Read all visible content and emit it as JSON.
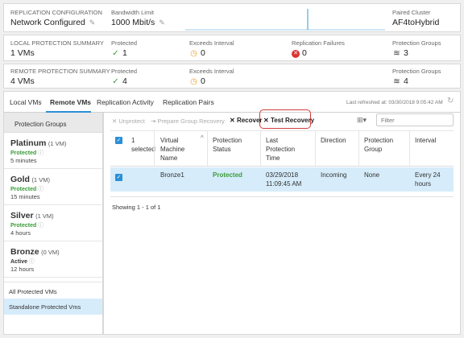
{
  "summary1": {
    "replication_configuration": {
      "label": "REPLICATION CONFIGURATION",
      "value": "Network Configured"
    },
    "bandwidth_limit": {
      "label": "Bandwidth Limit",
      "value": "1000 Mbit/s"
    },
    "paired_cluster": {
      "label": "Paired Cluster",
      "value": "AF4toHybrid"
    }
  },
  "local_summary": {
    "title": "LOCAL PROTECTION SUMMARY",
    "vms": "1 VMs",
    "protected": {
      "label": "Protected",
      "value": "1"
    },
    "exceeds_interval": {
      "label": "Exceeds Interval",
      "value": "0"
    },
    "replication_failures": {
      "label": "Replication Failures",
      "value": "0"
    },
    "protection_groups": {
      "label": "Protection Groups",
      "value": "3"
    }
  },
  "remote_summary": {
    "title": "REMOTE PROTECTION SUMMARY",
    "vms": "4 VMs",
    "protected": {
      "label": "Protected",
      "value": "4"
    },
    "exceeds_interval": {
      "label": "Exceeds Interval",
      "value": "0"
    },
    "protection_groups": {
      "label": "Protection Groups",
      "value": "4"
    }
  },
  "tabs": [
    {
      "label": "Local VMs"
    },
    {
      "label": "Remote VMs"
    },
    {
      "label": "Replication Activity"
    },
    {
      "label": "Replication Pairs"
    }
  ],
  "last_refreshed": "Last refreshed at: 03/30/2018 9:05:42 AM",
  "sidebar": {
    "header": "Protection Groups",
    "groups": [
      {
        "name": "Platinum",
        "count": "(1 VM)",
        "status": "Protected",
        "interval": "5 minutes"
      },
      {
        "name": "Gold",
        "count": "(1 VM)",
        "status": "Protected",
        "interval": "15 minutes"
      },
      {
        "name": "Silver",
        "count": "(1 VM)",
        "status": "Protected",
        "interval": "4 hours"
      },
      {
        "name": "Bronze",
        "count": "(0 VM)",
        "status": "Active",
        "interval": "12 hours"
      }
    ],
    "all_protected": "All Protected VMs",
    "standalone": "Standalone Protected Vms"
  },
  "toolbar": {
    "unprotect": "Unprotect",
    "prepare_group_recovery": "Prepare Group Recovery",
    "recover": "Recover",
    "test_recovery": "Test Recovery",
    "filter_placeholder": "Filter"
  },
  "table": {
    "selected_count": "1",
    "selected_label": "selected",
    "headers": {
      "vm_line1": "Virtual",
      "vm_line2": "Machine",
      "vm_line3": "Name",
      "status_line1": "Protection",
      "status_line2": "Status",
      "last_line1": "Last",
      "last_line2": "Protection",
      "last_line3": "Time",
      "direction": "Direction",
      "group_line1": "Protection",
      "group_line2": "Group",
      "interval": "Interval"
    },
    "rows": [
      {
        "vm": "Bronze1",
        "status": "Protected",
        "time_line1": "03/29/2018",
        "time_line2": "11:09:45 AM",
        "direction": "Incoming",
        "group": "None",
        "interval_line1": "Every 24",
        "interval_line2": "hours"
      }
    ],
    "showing": "Showing 1 - 1 of 1"
  },
  "colors": {
    "accent": "#2b8fd6",
    "protected_green": "#3a9b3a",
    "highlight_red": "#d33d3d",
    "selected_row": "#d6ecfa"
  }
}
